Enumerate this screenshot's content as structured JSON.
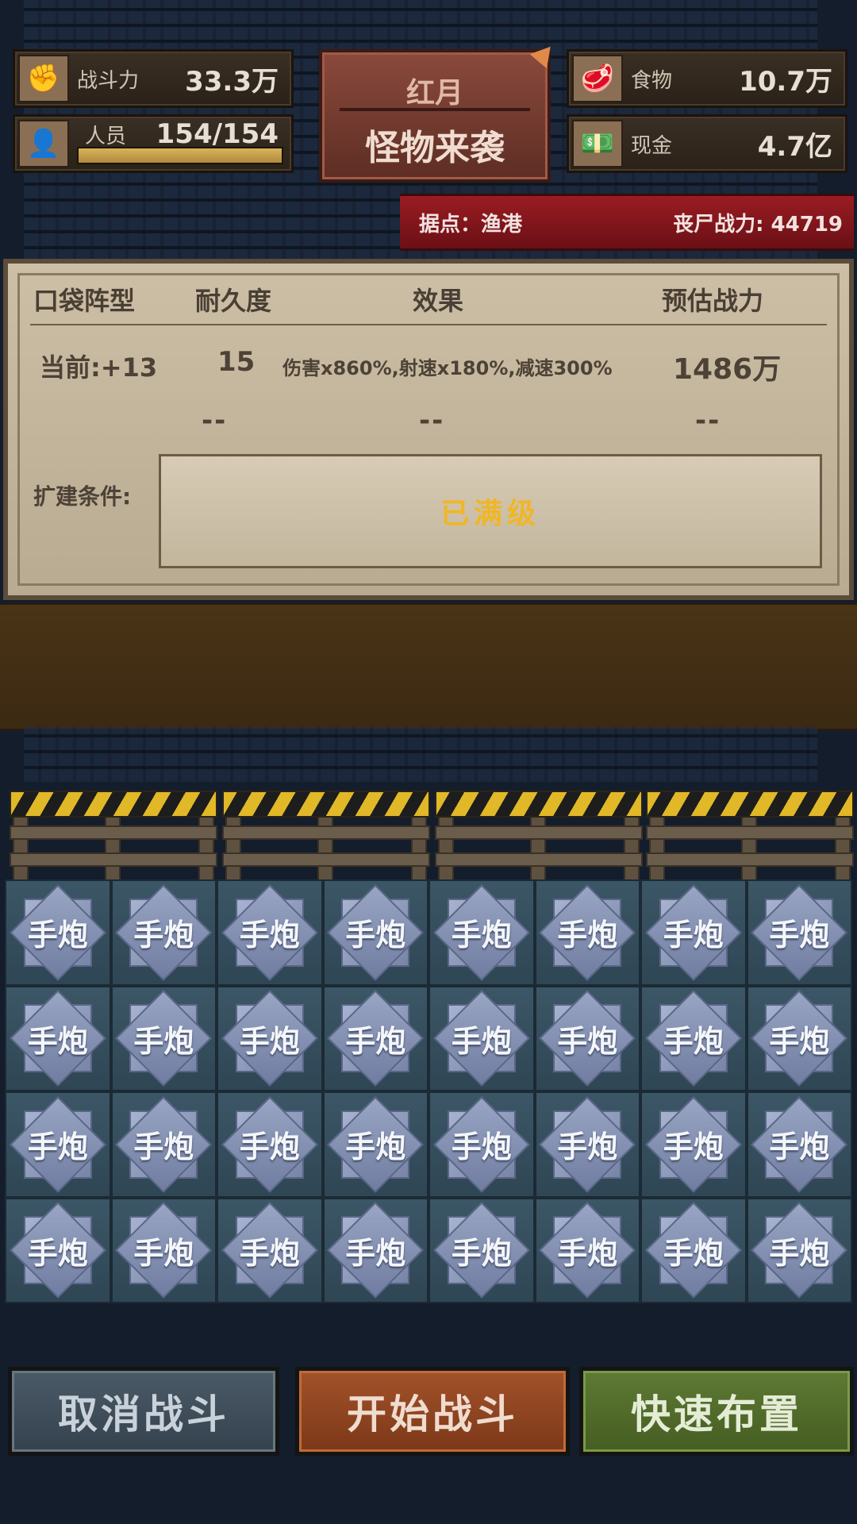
{
  "stats": {
    "combat_power": {
      "label": "战斗力",
      "value": "33.3万",
      "icon": "fist-icon"
    },
    "personnel": {
      "label": "人员",
      "value": "154/154",
      "fill": 1.0,
      "icon": "person-icon"
    },
    "food": {
      "label": "食物",
      "value": "10.7万",
      "icon": "meat-icon"
    },
    "cash": {
      "label": "现金",
      "value": "4.7亿",
      "icon": "cash-icon"
    }
  },
  "event": {
    "line1": "红月",
    "line2": "怪物来袭"
  },
  "outpost": {
    "label": "据点：渔港",
    "zombie_power": "丧尸战力: 44719"
  },
  "panel": {
    "headers": [
      "口袋阵型",
      "耐久度",
      "效果",
      "预估战力"
    ],
    "current": {
      "level": "当前:+13",
      "durability": "15",
      "effect": "伤害x860%,射速x180%,减速300%",
      "power": "1486万"
    },
    "next": {
      "durability": "--",
      "effect": "--",
      "power": "--"
    },
    "condition_label": "扩建条件:",
    "condition_value": "已满级"
  },
  "grid": {
    "unit_label": "手炮",
    "rows": 4,
    "cols": 8
  },
  "buttons": {
    "cancel": "取消战斗",
    "start": "开始战斗",
    "quick": "快速布置"
  },
  "colors": {
    "maxed_text": "#f0b624",
    "outpost_banner": "#9a1c22",
    "start_button": "#a2522a",
    "quick_button": "#5e7a34"
  }
}
